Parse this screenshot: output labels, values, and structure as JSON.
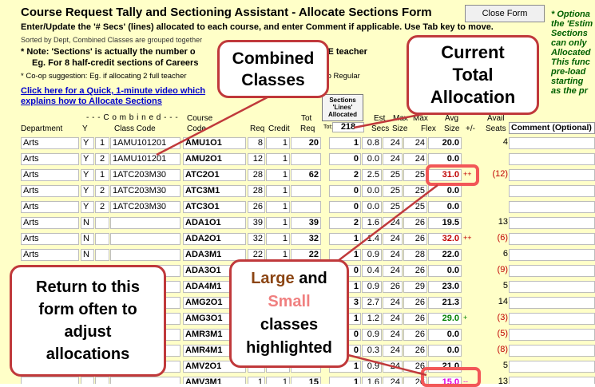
{
  "title": "Course Request Tally and Sectioning Assistant - Allocate Sections Form",
  "close_button": "Close Form",
  "side_note": [
    "* Optiona",
    "the 'Estim",
    "Sections",
    "can only",
    "Allocated",
    "This func",
    "pre-load",
    "starting",
    "as the pr"
  ],
  "instruction": "Enter/Update the '# Secs' (lines) allocated to each course, and enter Comment if applicable.  Use Tab key to move.",
  "sorted_note": "Sorted by Dept, Combined Classes are grouped together",
  "note1": "* Note: 'Sections' is actually the number o",
  "note1_tail": "FTE teacher",
  "note2": "Eg. For 8 half-credit sections of Careers",
  "coop_note": "* Co-op suggestion:  Eg. if allocating 2 full teacher",
  "coop_tail": "nes') to Regular",
  "video_link": [
    "Click here for a Quick, 1-minute video which",
    "explains how to Allocate Sections"
  ],
  "headers": {
    "combined": "- - -  C o m b i n e d  - - -",
    "department": "Department",
    "y": "Y",
    "class_code": "Class Code",
    "course_top": "Course",
    "course_code": "Code",
    "req": "Req",
    "credit": "Credit",
    "tot_top": "Tot",
    "tot": "Req",
    "sections_box": [
      "Sections",
      "'Lines'",
      "Allocated"
    ],
    "total_label": "Tot:",
    "total_alloc": "218",
    "est_top": "Est",
    "est": "Secs",
    "max_top": "Max",
    "max": "Size",
    "maxflex_top": "Max",
    "maxflex": "Flex",
    "avg_top": "Avg",
    "avg": "Size",
    "plusminus": "+/-",
    "avail_top": "Avail",
    "avail": "Seats",
    "comment": "Comment (Optional)"
  },
  "rows": [
    {
      "dept": "Arts",
      "y": "Y",
      "g": "1",
      "cls": "1AMU101201",
      "code": "AMU1O1",
      "req": "8",
      "cr": "1",
      "tot": "20",
      "secs": "1",
      "est": "0.8",
      "max": "24",
      "flex": "24",
      "avg": "20.0",
      "pm": "",
      "avail": "4"
    },
    {
      "dept": "Arts",
      "y": "Y",
      "g": "2",
      "cls": "1AMU101201",
      "code": "AMU2O1",
      "req": "12",
      "cr": "1",
      "tot": "",
      "secs": "0",
      "est": "0.0",
      "max": "24",
      "flex": "24",
      "avg": "0.0",
      "pm": "",
      "avail": ""
    },
    {
      "dept": "Arts",
      "y": "Y",
      "g": "1",
      "cls": "1ATC203M30",
      "code": "ATC2O1",
      "req": "28",
      "cr": "1",
      "tot": "62",
      "secs": "2",
      "est": "2.5",
      "max": "25",
      "flex": "25",
      "avg": "31.0",
      "pm": "++",
      "avail": "(12)"
    },
    {
      "dept": "Arts",
      "y": "Y",
      "g": "2",
      "cls": "1ATC203M30",
      "code": "ATC3M1",
      "req": "28",
      "cr": "1",
      "tot": "",
      "secs": "0",
      "est": "0.0",
      "max": "25",
      "flex": "25",
      "avg": "0.0",
      "pm": "",
      "avail": ""
    },
    {
      "dept": "Arts",
      "y": "Y",
      "g": "2",
      "cls": "1ATC203M30",
      "code": "ATC3O1",
      "req": "26",
      "cr": "1",
      "tot": "",
      "secs": "0",
      "est": "0.0",
      "max": "25",
      "flex": "25",
      "avg": "0.0",
      "pm": "",
      "avail": ""
    },
    {
      "dept": "Arts",
      "y": "N",
      "g": "",
      "cls": "",
      "code": "ADA1O1",
      "req": "39",
      "cr": "1",
      "tot": "39",
      "secs": "2",
      "est": "1.6",
      "max": "24",
      "flex": "26",
      "avg": "19.5",
      "pm": "",
      "avail": "13"
    },
    {
      "dept": "Arts",
      "y": "N",
      "g": "",
      "cls": "",
      "code": "ADA2O1",
      "req": "32",
      "cr": "1",
      "tot": "32",
      "secs": "1",
      "est": "1.4",
      "max": "24",
      "flex": "26",
      "avg": "32.0",
      "pm": "++",
      "avail": "(6)"
    },
    {
      "dept": "Arts",
      "y": "N",
      "g": "",
      "cls": "",
      "code": "ADA3M1",
      "req": "22",
      "cr": "1",
      "tot": "22",
      "secs": "1",
      "est": "0.9",
      "max": "24",
      "flex": "28",
      "avg": "22.0",
      "pm": "",
      "avail": "6"
    },
    {
      "dept": "",
      "y": "",
      "g": "",
      "cls": "",
      "code": "ADA3O1",
      "req": "",
      "cr": "",
      "tot": "",
      "secs": "0",
      "est": "0.4",
      "max": "24",
      "flex": "26",
      "avg": "0.0",
      "pm": "",
      "avail": "(9)"
    },
    {
      "dept": "",
      "y": "",
      "g": "",
      "cls": "",
      "code": "ADA4M1",
      "req": "",
      "cr": "",
      "tot": "",
      "secs": "1",
      "est": "0.9",
      "max": "26",
      "flex": "29",
      "avg": "23.0",
      "pm": "",
      "avail": "5"
    },
    {
      "dept": "",
      "y": "",
      "g": "",
      "cls": "",
      "code": "AMG2O1",
      "req": "",
      "cr": "",
      "tot": "",
      "secs": "3",
      "est": "2.7",
      "max": "24",
      "flex": "26",
      "avg": "21.3",
      "pm": "",
      "avail": "14"
    },
    {
      "dept": "",
      "y": "",
      "g": "",
      "cls": "",
      "code": "AMG3O1",
      "req": "",
      "cr": "",
      "tot": "",
      "secs": "1",
      "est": "1.2",
      "max": "24",
      "flex": "26",
      "avg": "29.0",
      "pm": "+",
      "avail": "(3)"
    },
    {
      "dept": "",
      "y": "",
      "g": "",
      "cls": "",
      "code": "AMR3M1",
      "req": "",
      "cr": "",
      "tot": "",
      "secs": "0",
      "est": "0.9",
      "max": "24",
      "flex": "26",
      "avg": "0.0",
      "pm": "",
      "avail": "(5)"
    },
    {
      "dept": "",
      "y": "",
      "g": "",
      "cls": "",
      "code": "AMR4M1",
      "req": "",
      "cr": "",
      "tot": "",
      "secs": "0",
      "est": "0.3",
      "max": "24",
      "flex": "26",
      "avg": "0.0",
      "pm": "",
      "avail": "(8)"
    },
    {
      "dept": "",
      "y": "",
      "g": "",
      "cls": "",
      "code": "AMV2O1",
      "req": "",
      "cr": "",
      "tot": "",
      "secs": "1",
      "est": "0.9",
      "max": "24",
      "flex": "26",
      "avg": "21.0",
      "pm": "",
      "avail": "5"
    },
    {
      "dept": "",
      "y": "",
      "g": "",
      "cls": "",
      "code": "AMV3M1",
      "req": "1",
      "cr": "1",
      "tot": "15",
      "secs": "1",
      "est": "1.6",
      "max": "24",
      "flex": "26",
      "avg": "15.0",
      "pm": "--",
      "avail": "13"
    }
  ],
  "callouts": {
    "combined": [
      "Combined",
      "Classes"
    ],
    "current": [
      "Current",
      "Total",
      "Allocation"
    ],
    "return": [
      "Return to this",
      "form often to",
      "adjust",
      "allocations"
    ],
    "large": "Large",
    "and": " and",
    "small": "Small",
    "classes": "classes",
    "highlighted": "highlighted"
  },
  "colors": {
    "form_bg": "#ffffc8",
    "large_avg": "#c00000",
    "small_avg": "#e000e0",
    "good_avg": "#008000",
    "callout_border": "#c0393b",
    "large_word": "#8b4513",
    "small_word": "#f08080",
    "link": "#0000cc"
  }
}
